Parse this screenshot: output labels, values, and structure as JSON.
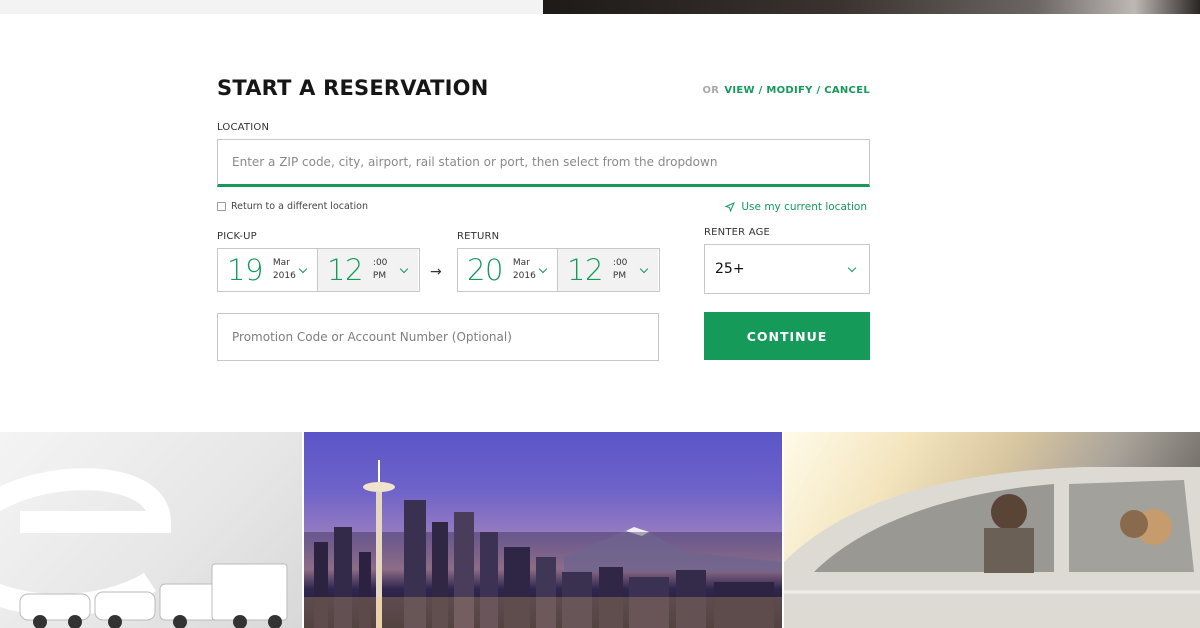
{
  "header": {
    "title": "START A RESERVATION",
    "or_text": "OR",
    "modify_link": "VIEW / MODIFY / CANCEL"
  },
  "location": {
    "label": "LOCATION",
    "placeholder": "Enter a ZIP code, city, airport, rail station or port, then select from the dropdown",
    "return_different_label": "Return to a different location",
    "use_current_label": "Use my current location"
  },
  "pickup": {
    "label": "PICK-UP",
    "day": "19",
    "month": "Mar",
    "year": "2016",
    "hour": "12",
    "minutes": ":00",
    "ampm": "PM"
  },
  "return": {
    "label": "RETURN",
    "day": "20",
    "month": "Mar",
    "year": "2016",
    "hour": "12",
    "minutes": ":00",
    "ampm": "PM"
  },
  "arrow": "→",
  "renter_age": {
    "label": "RENTER AGE",
    "value": "25+"
  },
  "promo": {
    "placeholder": "Promotion Code or Account Number (Optional)"
  },
  "continue_label": "CONTINUE",
  "colors": {
    "accent": "#169a5a"
  }
}
